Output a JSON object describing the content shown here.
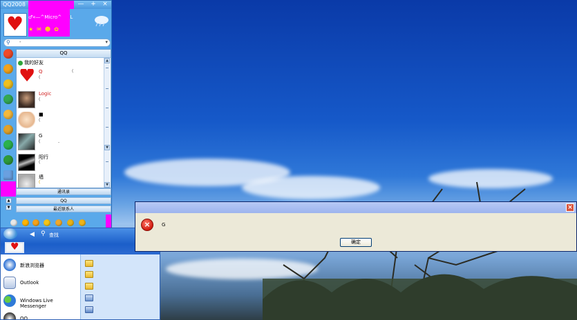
{
  "qq": {
    "title": "QQ2008",
    "window_controls": {
      "minimize": "—",
      "maximize": "+",
      "close": "×"
    },
    "nickname": "♂«—^Micro^",
    "nickname_suffix": "L",
    "search_value": "-",
    "search_dropdown": "▾",
    "panel_header": "QQ",
    "group_name": "我的好友",
    "friends": [
      {
        "name": "Q",
        "signature": "(",
        "extra": "(",
        "name_color": "#d02020"
      },
      {
        "name": "Logic",
        "signature": "(",
        "extra": "",
        "name_color": "#d02020"
      },
      {
        "name": "■",
        "signature": "(",
        "extra": "",
        "name_color": "#000000"
      },
      {
        "name": "G",
        "signature": "(",
        "extra": "-",
        "name_color": "#000000"
      },
      {
        "name": "阳行",
        "signature": "(",
        "extra": "",
        "name_color": "#000000"
      },
      {
        "name": "墙",
        "signature": "(",
        "extra": "",
        "name_color": "#000000"
      }
    ],
    "tabs": [
      "通讯录",
      "QQ",
      "最近联系人"
    ],
    "footer_search": "查找"
  },
  "start_menu": {
    "items": [
      "新浪浏览器",
      "Outlook",
      "Windows Live Messenger",
      "QQ"
    ]
  },
  "dialog": {
    "close_label": "×",
    "error_glyph": "×",
    "message": "G",
    "ok_label": "确定"
  },
  "colors": {
    "accent": "#5aa9ea",
    "magenta": "#ff00ff",
    "error": "#d11b0f"
  }
}
